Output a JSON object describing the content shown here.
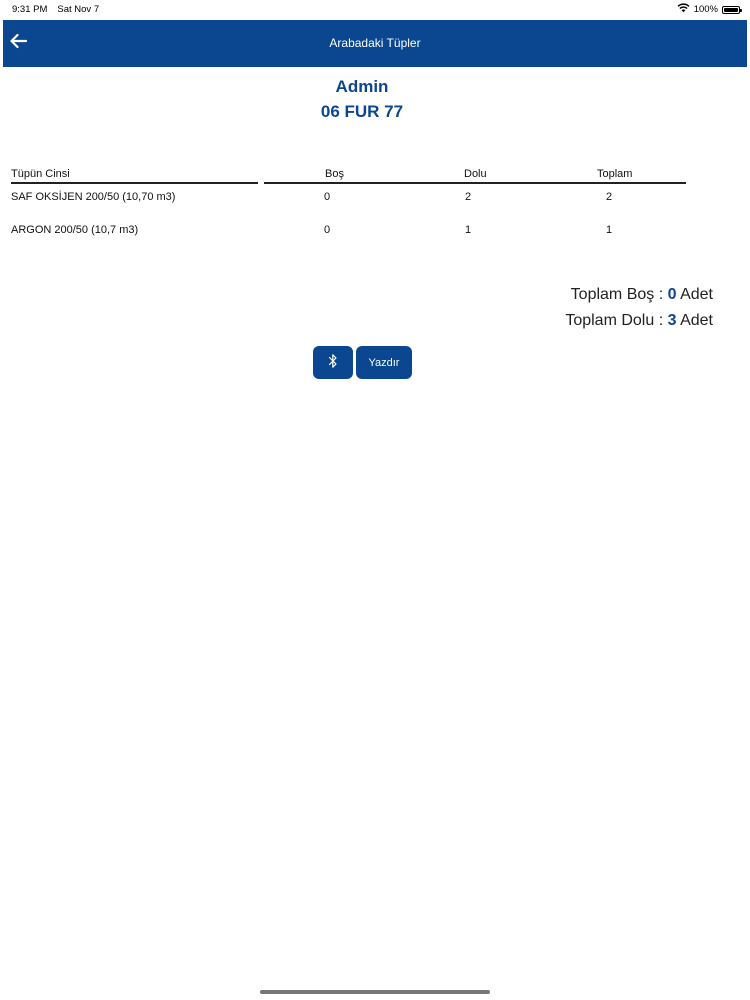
{
  "status_bar": {
    "time": "9:31 PM",
    "date": "Sat Nov 7",
    "battery": "100%",
    "battery_level": 1.0
  },
  "nav": {
    "title": "Arabadaki Tüpler",
    "back_icon": "arrow-left-icon"
  },
  "header": {
    "user": "Admin",
    "plate": "06 FUR 77"
  },
  "table": {
    "columns": [
      "Tüpün Cinsi",
      "Boş",
      "Dolu",
      "Toplam"
    ],
    "rows": [
      [
        "SAF OKSİJEN 200/50 (10,70 m3)",
        "0",
        "2",
        "2"
      ],
      [
        "ARGON 200/50 (10,7 m3)",
        "0",
        "1",
        "1"
      ]
    ]
  },
  "totals": {
    "empty_label": "Toplam Boş :",
    "empty_value": "0",
    "full_label": "Toplam Dolu :",
    "full_value": "3",
    "unit": "Adet"
  },
  "actions": {
    "bluetooth_icon": "bluetooth-icon",
    "print_label": "Yazdır"
  },
  "colors": {
    "brand": "#0b4690"
  }
}
